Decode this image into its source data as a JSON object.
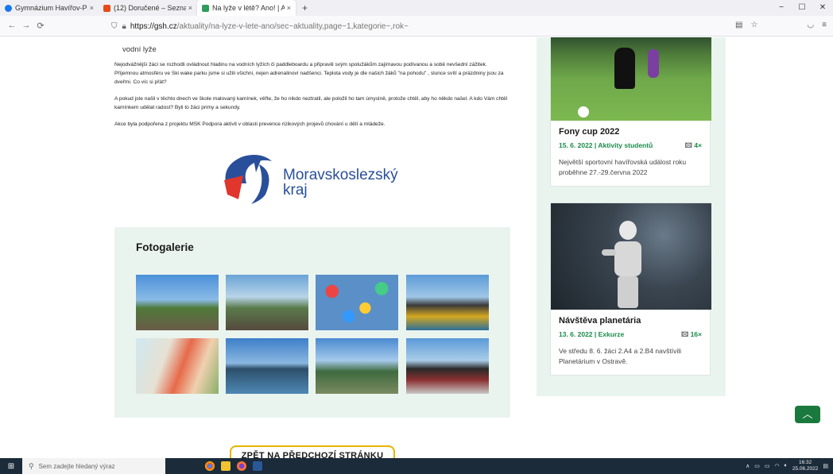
{
  "tabs": [
    {
      "label": "Gymnázium Havířov-Po",
      "close": "×",
      "color": "#1877f2",
      "active": false
    },
    {
      "label": "(12) Doručené – Seznan",
      "close": "×",
      "color": "#e64a19",
      "active": false
    },
    {
      "label": "Na lyže v létě? Ano! | Al",
      "close": "×",
      "color": "#2e9c5c",
      "active": true
    }
  ],
  "new_tab": "+",
  "window_controls": [
    "−",
    "☐",
    "✕"
  ],
  "url": {
    "host": "https://gsh.cz",
    "path": "/aktuality/na-lyze-v-lete-ano/sec~aktuality,page~1,kategorie~,rok~"
  },
  "article": {
    "lead": "vodní lyže",
    "p1": "Nejodvážnější žáci se rozhodli ovládnout hladinu na vodních lyžích či paddleboardu a připravili svým spolužákům zajímavou podívanou a sobě nevšední zážitek.  Příjemnou atmosféru ve Ski wake parku jsme si užili všichni, nejen adrenalinoví nadšenci.  Teplota vody je dle našich žáků \"na pohodu\" , slunce svítí a prázdniny jsou za dveřmi. Co víc si přát?",
    "p2": "A pokud jste našli v těchto dnech ve škole malovaný kamínek, věřte, že ho nikdo neztratil, ale položil ho tam úmyslně, protože chtěl, aby ho někdo našel.  A kdo Vám chtěl kamínkem udělat radost? Byli to žáci primy a sekundy.",
    "p3": "Akce byla podpořena z projektu MSK Podpora aktivit v oblasti prevence rizikových projevů chování u dětí a mládeže.",
    "logo_line1": "Moravskoslezský",
    "logo_line2": "kraj"
  },
  "gallery": {
    "title": "Fotogalerie"
  },
  "back_button": "ZPĚT NA PŘEDCHOZÍ STRÁNKU",
  "sidebar": {
    "cards": [
      {
        "title": "Fony cup 2022",
        "meta": "15. 6. 2022 | Aktivity studentů",
        "count": "4×",
        "desc": "Největší sportovní havířovská událost roku proběhne 27.-29.června 2022"
      },
      {
        "title": "Návštěva planetária",
        "meta": "13. 6. 2022 | Exkurze",
        "count": "16×",
        "desc": "Ve středu 8. 6. žáci 2.A4 a 2.B4 navštívili Planetárium v Ostravě."
      }
    ]
  },
  "taskbar": {
    "search_placeholder": "Sem zadejte hledaný výraz",
    "time": "16:32",
    "date": "25.06.2022"
  }
}
